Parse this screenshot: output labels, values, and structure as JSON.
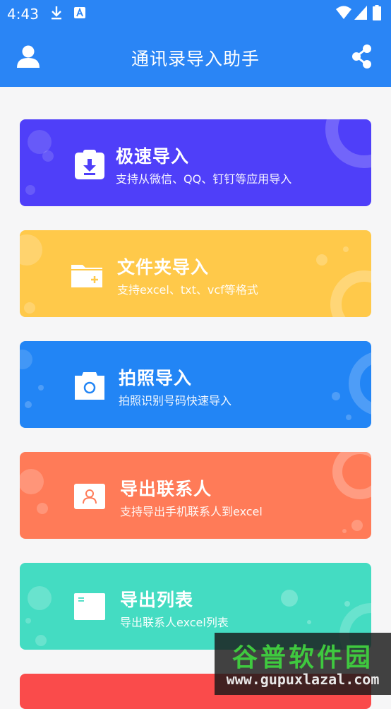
{
  "status_bar": {
    "time": "4:43",
    "icons": [
      "download-icon",
      "a-badge-icon",
      "wifi-icon",
      "signal-icon",
      "battery-icon"
    ]
  },
  "app_bar": {
    "title": "通讯录导入助手",
    "left_icon": "user-icon",
    "right_icon": "share-icon"
  },
  "cards": [
    {
      "title": "极速导入",
      "subtitle": "支持从微信、QQ、钉钉等应用导入",
      "color": "#4f3ff9",
      "icon": "clipboard-download-icon"
    },
    {
      "title": "文件夹导入",
      "subtitle": "支持excel、txt、vcf等格式",
      "color": "#ffc94a",
      "icon": "folder-add-icon"
    },
    {
      "title": "拍照导入",
      "subtitle": "拍照识别号码快速导入",
      "color": "#2285f5",
      "icon": "camera-icon"
    },
    {
      "title": "导出联系人",
      "subtitle": "支持导出手机联系人到excel",
      "color": "#ff7b58",
      "icon": "contact-card-icon"
    },
    {
      "title": "导出列表",
      "subtitle": "导出联系人excel列表",
      "color": "#44dcc2",
      "icon": "list-window-icon"
    }
  ],
  "partial_card_color": "#fa4b4b",
  "watermark": {
    "brand": "谷普软件园",
    "url": "www.gupuxlazal.com"
  }
}
